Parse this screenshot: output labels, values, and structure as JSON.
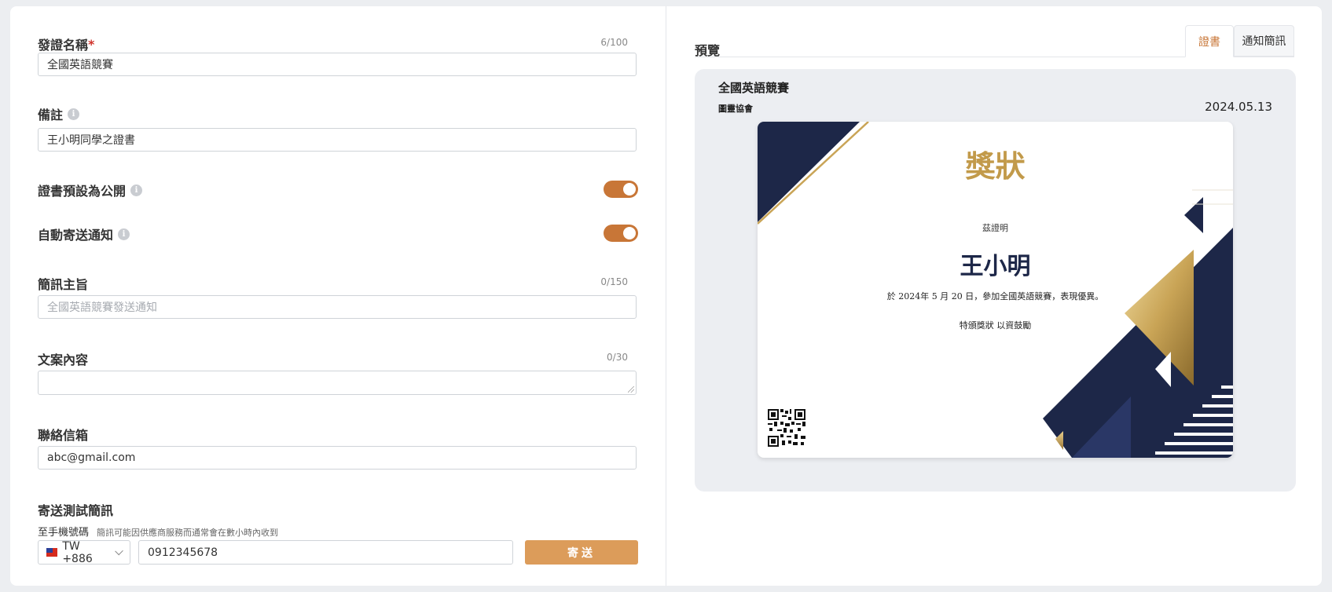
{
  "form": {
    "cert_name": {
      "label": "發證名稱",
      "required_mark": "*",
      "counter": "6/100",
      "value": "全國英語競賽"
    },
    "note": {
      "label": "備註",
      "value": "王小明同學之證書"
    },
    "public_default": {
      "label": "證書預設為公開",
      "on": true
    },
    "auto_notify": {
      "label": "自動寄送通知",
      "on": true
    },
    "sms_subject": {
      "label": "簡訊主旨",
      "counter": "0/150",
      "placeholder": "全國英語競賽發送通知"
    },
    "content": {
      "label": "文案內容",
      "counter": "0/30",
      "value": ""
    },
    "email": {
      "label": "聯絡信箱",
      "value": "abc@gmail.com"
    },
    "test_sms": {
      "label": "寄送測試簡訊",
      "phone_label": "至手機號碼",
      "phone_note": "簡訊可能因供應商服務而通常會在數小時內收到",
      "country_code": "TW +886",
      "phone_value": "0912345678",
      "send_label": "寄送"
    }
  },
  "preview": {
    "title": "預覽",
    "tabs": [
      {
        "label": "證書",
        "active": true
      },
      {
        "label": "通知簡訊",
        "active": false
      }
    ],
    "cert_name": "全國英語競賽",
    "org": "圖靈協會",
    "date": "2024.05.13",
    "certificate": {
      "title": "獎狀",
      "prefix": "茲證明",
      "recipient": "王小明",
      "body": "於 2024年 5 月 20 日，參加全國英語競賽，表現優異。",
      "closing": "特頒獎狀 以資鼓勵"
    }
  },
  "colors": {
    "accent": "#c87637",
    "button": "#dc9c5a",
    "navy": "#1d2748",
    "gold": "#c29a4a"
  }
}
